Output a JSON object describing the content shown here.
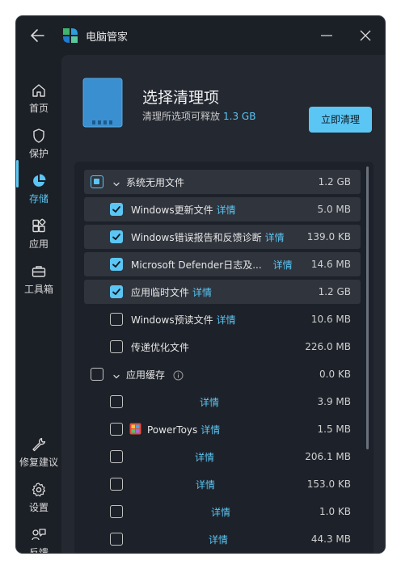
{
  "app": {
    "title": "电脑管家"
  },
  "sidebar": {
    "items": [
      {
        "label": "首页",
        "icon": "home-icon"
      },
      {
        "label": "保护",
        "icon": "shield-icon"
      },
      {
        "label": "存储",
        "icon": "pie-chart-icon",
        "active": true
      },
      {
        "label": "应用",
        "icon": "apps-icon"
      },
      {
        "label": "工具箱",
        "icon": "toolbox-icon"
      },
      {
        "label": "修复建议",
        "icon": "wrench-icon"
      },
      {
        "label": "设置",
        "icon": "gear-icon"
      },
      {
        "label": "反馈",
        "icon": "feedback-icon"
      }
    ]
  },
  "header": {
    "title": "选择清理项",
    "subtitle_prefix": "清理所选项可释放",
    "subtitle_size": "1.3 GB",
    "clean_button": "立即清理"
  },
  "colors": {
    "accent": "#5bc6f3",
    "background": "#1b1f26",
    "panel": "#232831"
  },
  "list": {
    "detail_label": "详情",
    "rows": [
      {
        "label": "系统无用文件",
        "size": "1.2 GB",
        "state": "partial",
        "group": true
      },
      {
        "label": "Windows更新文件",
        "size": "5.0 MB",
        "state": "checked"
      },
      {
        "label": "Windows错误报告和反馈诊断",
        "size": "139.0 KB",
        "state": "checked"
      },
      {
        "label": "Microsoft Defender日志及...",
        "size": "14.6 MB",
        "state": "checked"
      },
      {
        "label": "应用临时文件",
        "size": "1.2 GB",
        "state": "checked"
      },
      {
        "label": "Windows预读文件",
        "size": "10.6 MB",
        "state": "unchecked"
      },
      {
        "label": "传递优化文件",
        "size": "226.0 MB",
        "state": "unchecked"
      },
      {
        "label": "应用缓存",
        "size": "0.0 KB",
        "state": "unchecked",
        "group": true
      },
      {
        "label": "",
        "size": "3.9 MB",
        "state": "unchecked"
      },
      {
        "label": "PowerToys",
        "size": "1.5 MB",
        "state": "unchecked"
      },
      {
        "label": "",
        "size": "206.1 MB",
        "state": "unchecked"
      },
      {
        "label": "",
        "size": "153.0 KB",
        "state": "unchecked"
      },
      {
        "label": "",
        "size": "1.0 KB",
        "state": "unchecked"
      },
      {
        "label": "",
        "size": "44.3 MB",
        "state": "unchecked"
      }
    ]
  }
}
